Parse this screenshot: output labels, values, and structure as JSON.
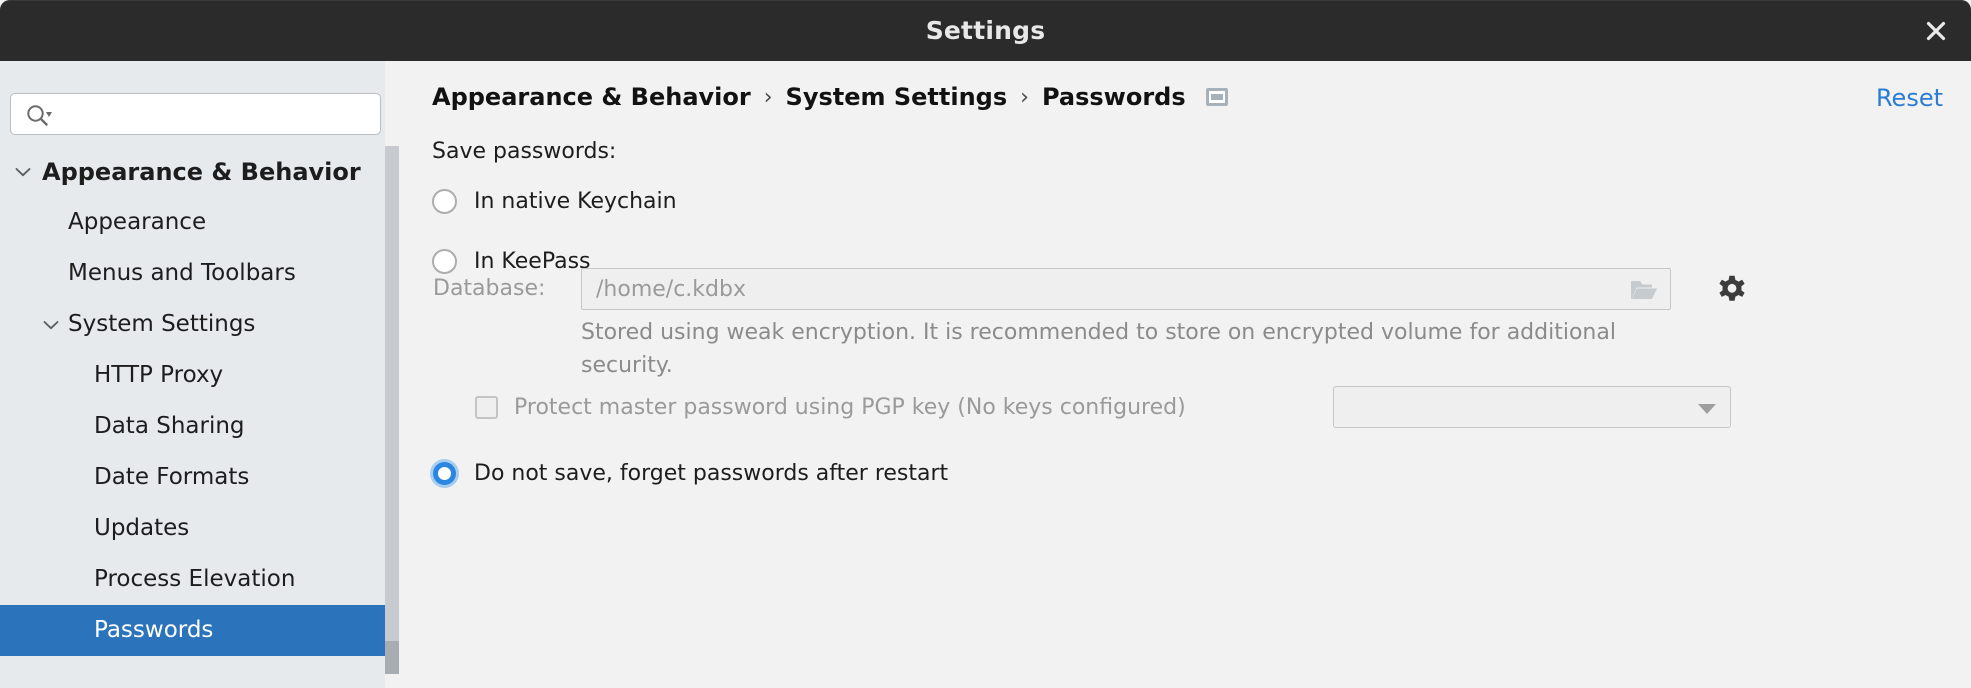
{
  "window": {
    "title": "Settings",
    "close_icon": "close-icon"
  },
  "sidebar": {
    "search": {
      "value": "",
      "placeholder": "",
      "icon": "search-icon"
    },
    "tree": [
      {
        "label": "Appearance & Behavior",
        "level": 0,
        "expanded": true,
        "selected": false
      },
      {
        "label": "Appearance",
        "level": 1,
        "expanded": null,
        "selected": false
      },
      {
        "label": "Menus and Toolbars",
        "level": 1,
        "expanded": null,
        "selected": false
      },
      {
        "label": "System Settings",
        "level": 1,
        "expanded": true,
        "selected": false
      },
      {
        "label": "HTTP Proxy",
        "level": 2,
        "expanded": null,
        "selected": false
      },
      {
        "label": "Data Sharing",
        "level": 2,
        "expanded": null,
        "selected": false
      },
      {
        "label": "Date Formats",
        "level": 2,
        "expanded": null,
        "selected": false
      },
      {
        "label": "Updates",
        "level": 2,
        "expanded": null,
        "selected": false
      },
      {
        "label": "Process Elevation",
        "level": 2,
        "expanded": null,
        "selected": false
      },
      {
        "label": "Passwords",
        "level": 2,
        "expanded": null,
        "selected": true
      }
    ]
  },
  "main": {
    "breadcrumb": {
      "items": [
        "Appearance & Behavior",
        "System Settings",
        "Passwords"
      ],
      "separator": "›",
      "trailing_icon": "window-icon"
    },
    "reset_label": "Reset",
    "save_passwords_label": "Save passwords:",
    "options": [
      {
        "label": "In native Keychain",
        "selected": false
      },
      {
        "label": "In KeePass",
        "selected": false
      },
      {
        "label": "Do not save, forget passwords after restart",
        "selected": true
      }
    ],
    "database": {
      "label": "Database:",
      "value": "/home/c.kdbx",
      "browse_icon": "folder-open-icon",
      "settings_icon": "gear-icon",
      "note": "Stored using weak encryption. It is recommended to store on encrypted volume for additional security."
    },
    "pgp": {
      "label": "Protect master password using PGP key (No keys configured)",
      "checked": false,
      "select_value": "",
      "select_arrow_icon": "chevron-down-icon"
    }
  },
  "colors": {
    "titlebar_bg": "#2b2b2b",
    "sidebar_bg": "#e6eaed",
    "selection_blue": "#2b74bb",
    "link_blue": "#2b7cd3",
    "radio_blue": "#2b86e0",
    "panel_bg": "#f2f2f2",
    "disabled_text": "#9a9a9a"
  }
}
